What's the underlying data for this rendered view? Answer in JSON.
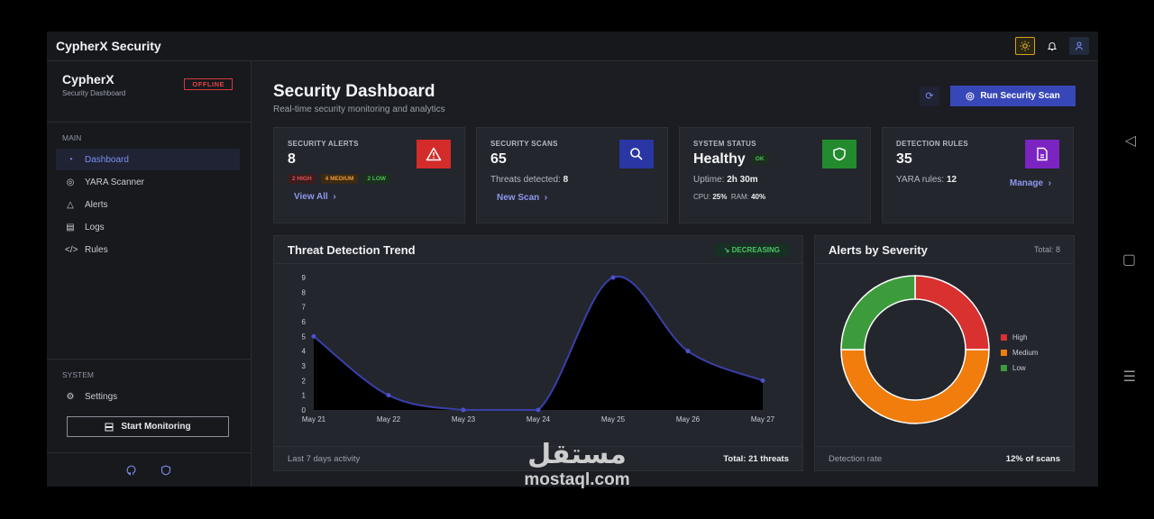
{
  "app": {
    "title": "CypherX Security"
  },
  "sidebar": {
    "brand": "CypherX",
    "subtitle": "Security Dashboard",
    "status": "OFFLINE",
    "main_section": "MAIN",
    "items": [
      {
        "label": "Dashboard",
        "icon": "dashboard-icon"
      },
      {
        "label": "YARA Scanner",
        "icon": "fingerprint-icon"
      },
      {
        "label": "Alerts",
        "icon": "warning-icon"
      },
      {
        "label": "Logs",
        "icon": "clipboard-icon"
      },
      {
        "label": "Rules",
        "icon": "code-icon"
      }
    ],
    "system_section": "SYSTEM",
    "settings": "Settings",
    "start_monitoring": "Start Monitoring"
  },
  "header": {
    "title": "Security Dashboard",
    "subtitle": "Real-time security monitoring and analytics",
    "scan_button": "Run Security Scan"
  },
  "cards": {
    "alerts": {
      "label": "SECURITY ALERTS",
      "value": "8",
      "high": "2 HIGH",
      "medium": "4 MEDIUM",
      "low": "2 LOW",
      "link": "View All"
    },
    "scans": {
      "label": "SECURITY SCANS",
      "value": "65",
      "detected_label": "Threats detected:",
      "detected_value": "8",
      "link": "New Scan"
    },
    "system": {
      "label": "SYSTEM STATUS",
      "value": "Healthy",
      "badge": "OK",
      "uptime_label": "Uptime:",
      "uptime_value": "2h 30m",
      "cpu_label": "CPU:",
      "cpu_value": "25%",
      "ram_label": "RAM:",
      "ram_value": "40%"
    },
    "rules": {
      "label": "DETECTION RULES",
      "value": "35",
      "yara_label": "YARA rules:",
      "yara_value": "12",
      "link": "Manage"
    }
  },
  "trend_panel": {
    "title": "Threat Detection Trend",
    "badge": "DECREASING",
    "footer_left": "Last 7 days activity",
    "footer_right": "Total: 21 threats"
  },
  "severity_panel": {
    "title": "Alerts by Severity",
    "total": "Total: 8",
    "footer_left": "Detection rate",
    "footer_right": "12% of scans"
  },
  "chart_data": [
    {
      "type": "area",
      "title": "Threat Detection Trend",
      "categories": [
        "May 21",
        "May 22",
        "May 23",
        "May 24",
        "May 25",
        "May 26",
        "May 27"
      ],
      "values": [
        5,
        1,
        0,
        0,
        9,
        4,
        2
      ],
      "ylim": [
        0,
        9
      ],
      "yticks": [
        0,
        1,
        2,
        3,
        4,
        5,
        6,
        7,
        8,
        9
      ],
      "color": "#3a3fa8",
      "grid": false
    },
    {
      "type": "pie",
      "title": "Alerts by Severity",
      "labels": [
        "High",
        "Medium",
        "Low"
      ],
      "values": [
        2,
        4,
        2
      ],
      "colors": [
        "#d93030",
        "#f07d0c",
        "#3c9c3c"
      ],
      "legend": "right"
    }
  ],
  "watermark": {
    "arabic": "مستقل",
    "latin": "mostaql.com"
  }
}
